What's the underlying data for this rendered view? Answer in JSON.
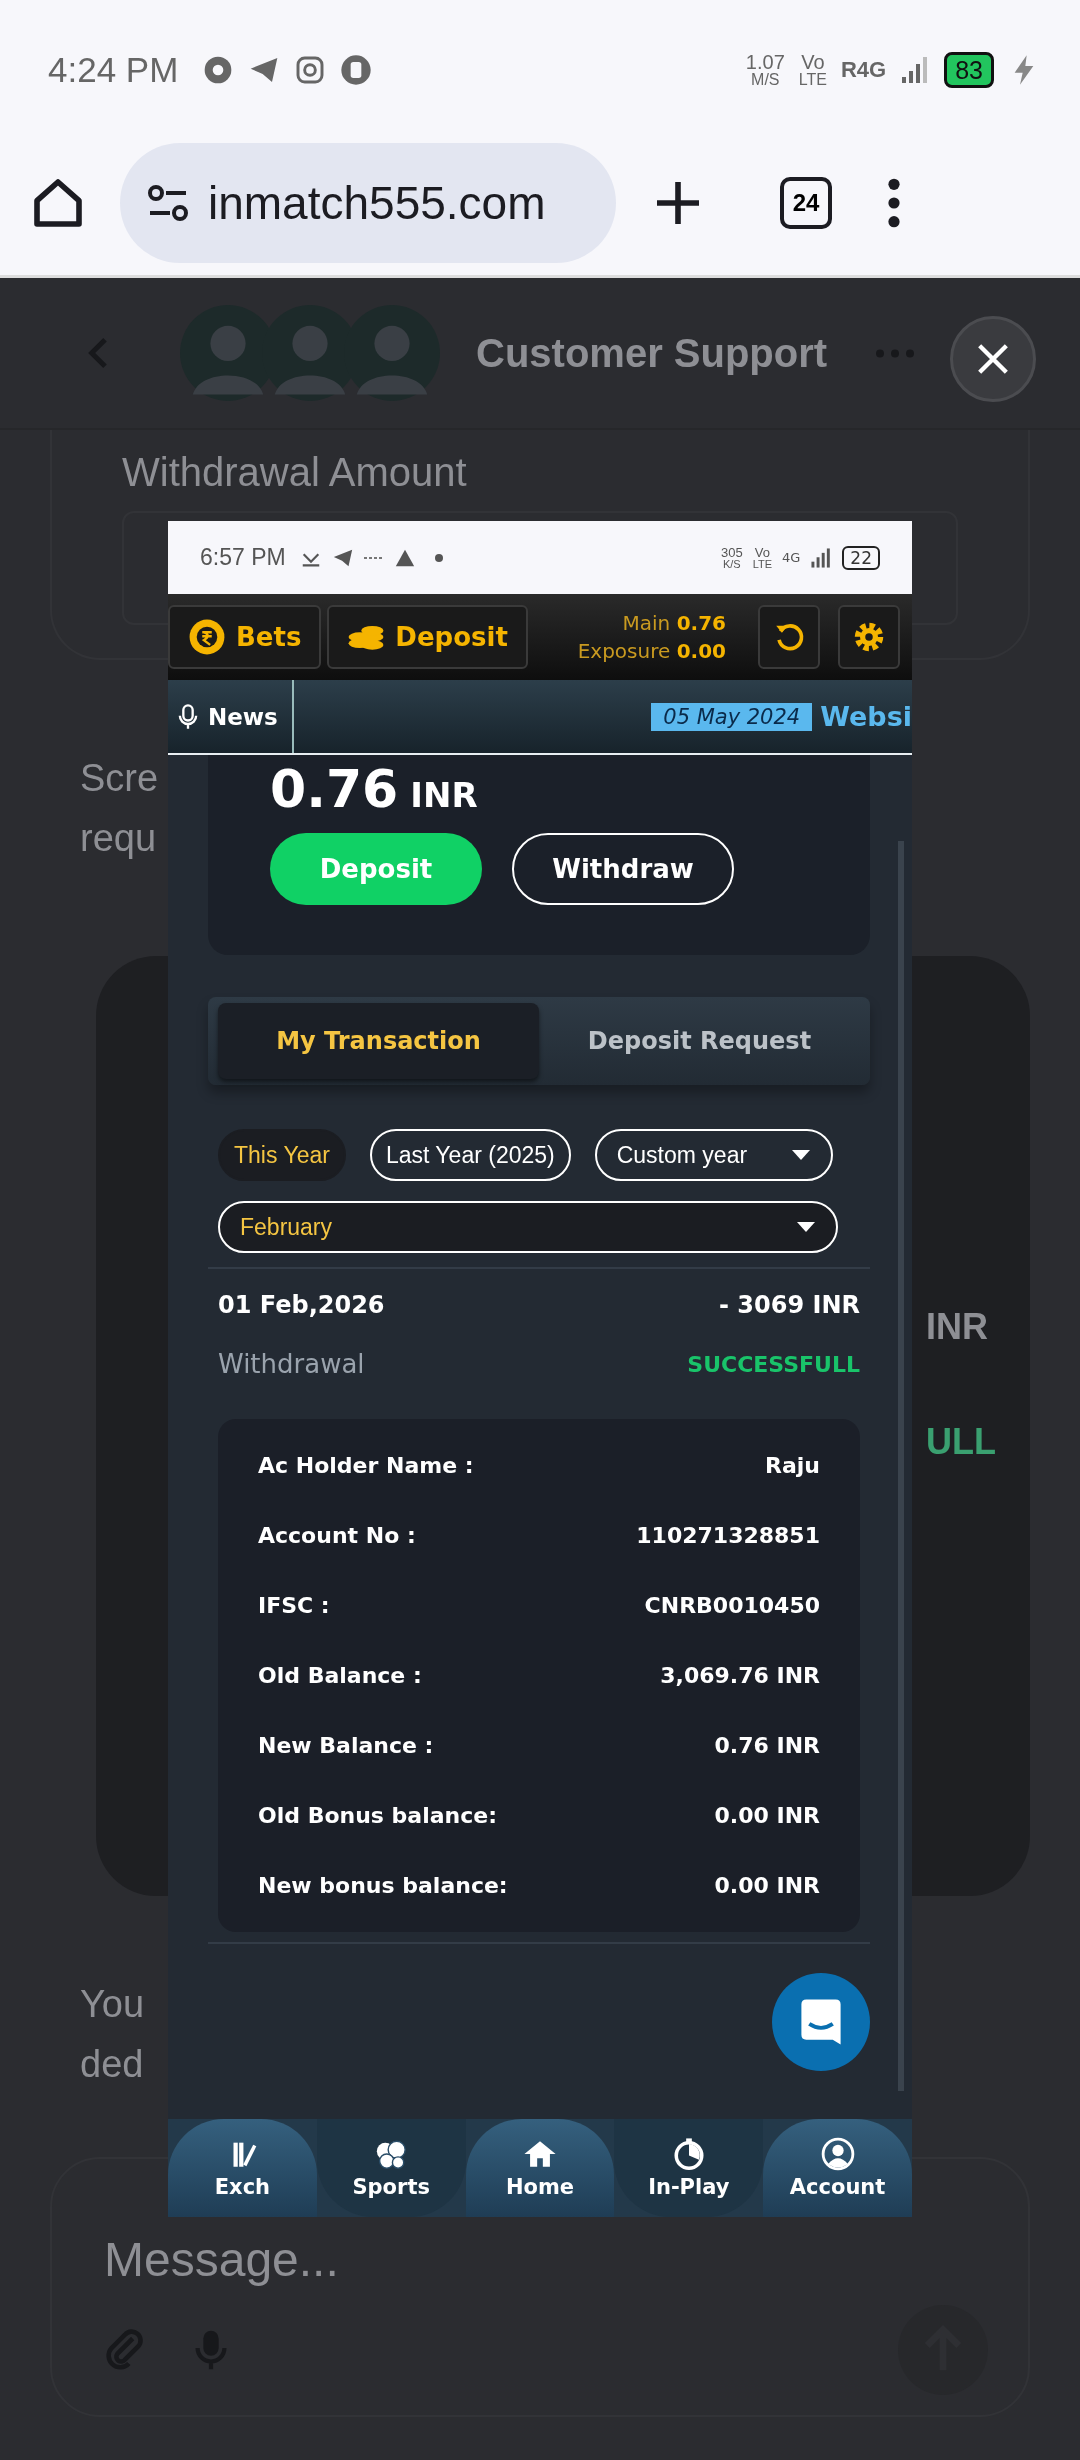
{
  "status_bar": {
    "time": "4:24 PM",
    "speed": "1.07",
    "speed_unit": "M/S",
    "volte_top": "Vo",
    "volte_bottom": "LTE",
    "network": "R4G",
    "battery": "83"
  },
  "browser": {
    "url": "inmatch555.com",
    "tab_count": "24"
  },
  "chat": {
    "title": "Customer Support",
    "field_label": "Withdrawal Amount",
    "fragments_left": [
      "Scre",
      "requ"
    ],
    "fragments_right": [
      "INR",
      "ULL"
    ],
    "fragments_bottom": [
      "You",
      "ded"
    ],
    "message": {
      "placeholder": "Message..."
    }
  },
  "screenshot": {
    "status_bar": {
      "time": "6:57 PM",
      "speed": "305",
      "speed_unit": "K/S",
      "volte_top": "Vo",
      "volte_bottom": "LTE",
      "network": "4G",
      "battery": "22"
    },
    "header": {
      "buttons": [
        "Bets",
        "Deposit"
      ],
      "main_label": "Main",
      "main_value": "0.76",
      "exposure_label": "Exposure",
      "exposure_value": "0.00"
    },
    "news": {
      "label": "News",
      "date": "05 May 2024",
      "ticker": "Websi"
    },
    "balance": {
      "amount": "0.76",
      "currency": "INR",
      "buttons": [
        {
          "label": "Deposit",
          "kind": "primary"
        },
        {
          "label": "Withdraw",
          "kind": "outline"
        }
      ]
    },
    "tabs": [
      {
        "label": "My Transaction",
        "selected": true
      },
      {
        "label": "Deposit Request",
        "selected": false
      }
    ],
    "filters": [
      {
        "label": "This Year",
        "selected": true
      },
      {
        "label": "Last Year (2025)",
        "selected": false
      }
    ],
    "year_select": {
      "value": "Custom year"
    },
    "month_select": {
      "value": "February"
    },
    "transaction": {
      "date": "01 Feb,2026",
      "amount": "- 3069 INR",
      "type": "Withdrawal",
      "status": "SUCCESSFULL",
      "details": [
        {
          "label": "Ac Holder Name :",
          "value": "Raju"
        },
        {
          "label": "Account No :",
          "value": "110271328851"
        },
        {
          "label": "IFSC :",
          "value": "CNRB0010450"
        },
        {
          "label": "Old Balance :",
          "value": "3,069.76 INR"
        },
        {
          "label": "New Balance :",
          "value": "0.76 INR"
        },
        {
          "label": "Old Bonus balance:",
          "value": "0.00 INR"
        },
        {
          "label": "New bonus balance:",
          "value": "0.00 INR"
        }
      ]
    },
    "nav": [
      {
        "label": "Exch"
      },
      {
        "label": "Sports"
      },
      {
        "label": "Home"
      },
      {
        "label": "In-Play"
      },
      {
        "label": "Account"
      }
    ]
  }
}
